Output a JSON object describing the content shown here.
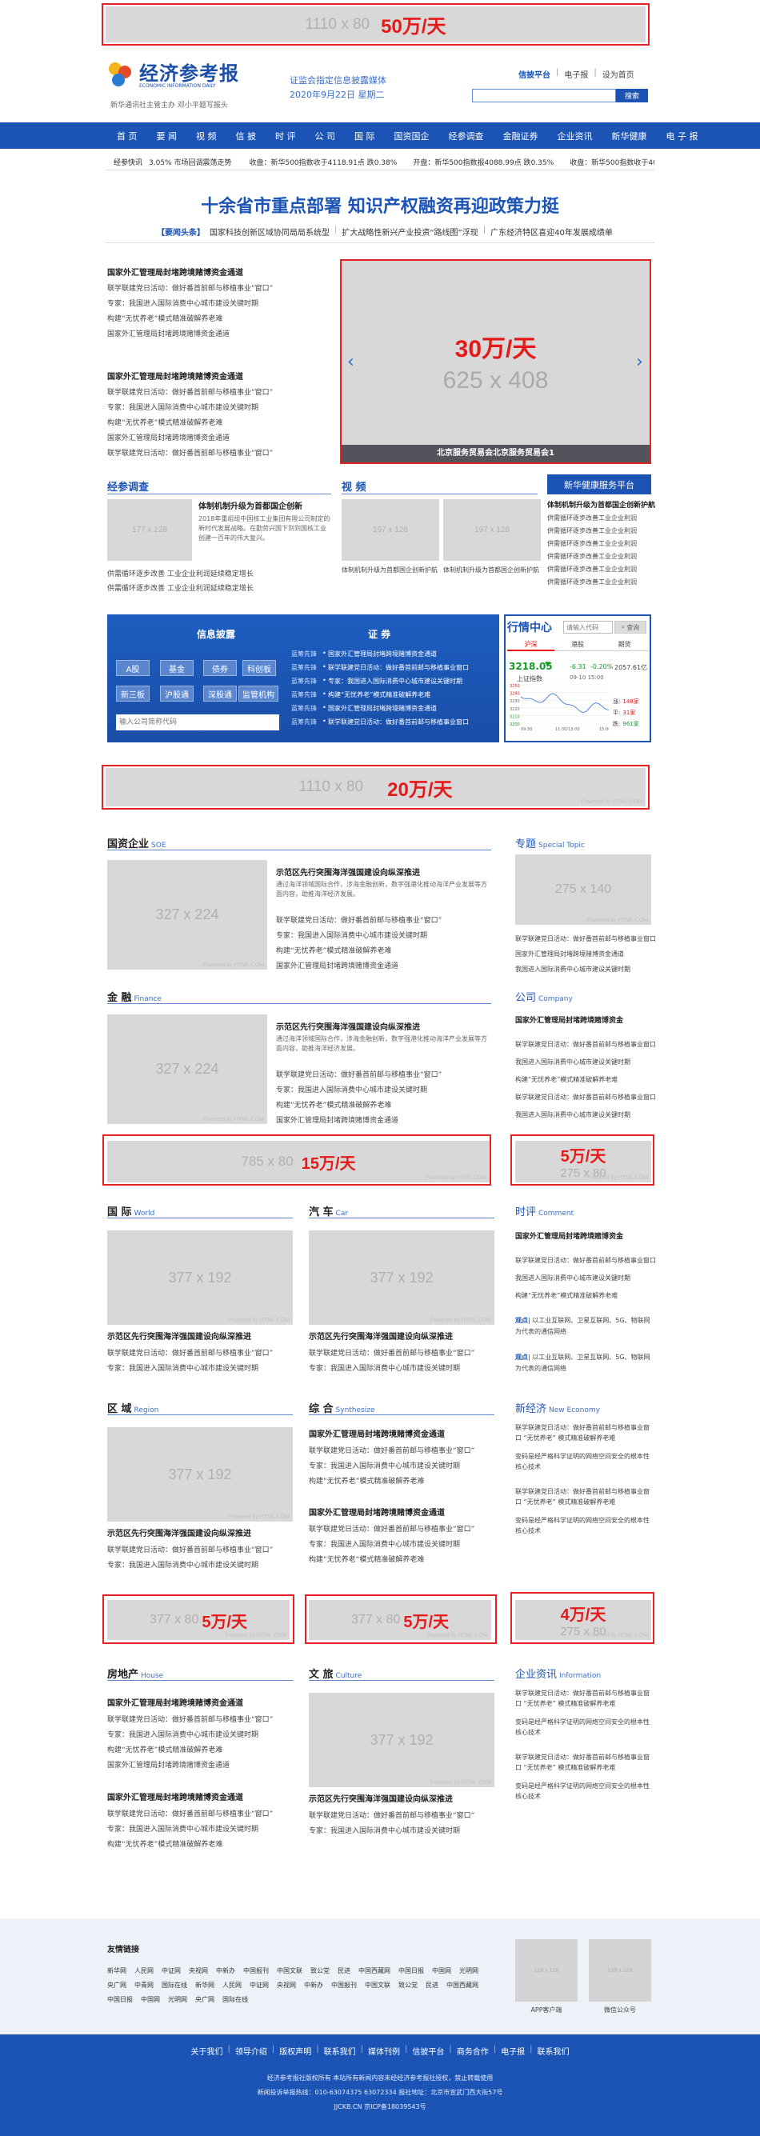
{
  "top_ad": {
    "size": "1110 x 80",
    "price": "50万/天"
  },
  "header": {
    "logo_text": "经济参考报",
    "logo_sub": "ECONOMIC INFORMATION DAILY",
    "slogan": "新华通讯社主管主办  邓小平题写报头",
    "media": "证监会指定信息披露媒体",
    "date": "2020年9月22日  星期二",
    "links": [
      "信披平台",
      "电子报",
      "设为首页"
    ],
    "search_btn": "搜索"
  },
  "nav": [
    "首 页",
    "要 闻",
    "视 频",
    "信 披",
    "时 评",
    "公 司",
    "国 际",
    "国资国企",
    "经参调查",
    "金融证券",
    "企业资讯",
    "新华健康",
    "电 子 报"
  ],
  "ticker": {
    "label": "经参快讯",
    "text": "3.05%  市场回调震荡走势",
    "items": [
      "收盘：新华500指数收于4118.91点 跌0.38%",
      "开盘：新华500指数报4088.99点 跌0.35%",
      "收盘：新华500指数收于4078.11点 跌0.57"
    ]
  },
  "headline": {
    "title": "十余省市重点部署   知识产权融资再迎政策力挺",
    "sub_tag": "【要闻头条】",
    "subs": [
      "国家科技创新区域协同局局系统型",
      "扩大战略性新兴产业投资“路线图”浮现",
      "广东经济特区喜迎40年发展成绩单"
    ]
  },
  "left_news": {
    "h1": "国家外汇管理局封堵跨境赌博资金通道",
    "items1": [
      "联学联建党日活动：做好番首前邮与移植事业“窗口”",
      "专家：我国进入国际消费中心城市建设关键时期",
      "构建“无忧养老”模式精准破解养老难",
      "国家外汇管理局封堵跨境赌博资金通道"
    ],
    "h2": "国家外汇管理局封堵跨境赌博资金通道",
    "items2": [
      "联学联建党日活动：做好番首前邮与移植事业“窗口”",
      "专家：我国进入国际消费中心城市建设关键时期",
      "构建“无忧养老”模式精准破解养老难",
      "国家外汇管理局封堵跨境赌博资金通道",
      "联学联建党日活动：做好番首前邮与移植事业“窗口”"
    ]
  },
  "slider": {
    "price": "30万/天",
    "size": "625 x 408",
    "caption": "北京服务贸易会北京服务贸易会1"
  },
  "survey": {
    "title": "经参调查",
    "img": "177 x 128",
    "headline": "体制机制升级为首都国企创新",
    "text": "2018年重组组中国核工业集团有限公司制定的新时代发展战略。在勤劳兴国下到到国核工业创建一百年的伟大复兴。",
    "items": [
      "供需循环逐步改善    工业企业利润延续稳定增长",
      "供需循环逐步改善    工业企业利润延续稳定增长"
    ]
  },
  "video": {
    "title": "视  频",
    "img1": "197 x 128",
    "img2": "197 x 128",
    "cap1": "体制机制升级为首都国企创新护航",
    "cap2": "体制机制升级为首都国企创新护航"
  },
  "health": {
    "btn": "新华健康服务平台",
    "headline": "体制机制升级为首都国企创新护航",
    "items": [
      "供需循环逐步改善工业企业利润",
      "供需循环逐步改善工业企业利润",
      "供需循环逐步改善工业企业利润",
      "供需循环逐步改善工业企业利润",
      "供需循环逐步改善工业企业利润",
      "供需循环逐步改善工业企业利润"
    ]
  },
  "info": {
    "title": "信息披露",
    "buttons": [
      "A股",
      "基金",
      "债券",
      "科创板",
      "新三板",
      "沪股通",
      "深股通",
      "监管机构"
    ],
    "input_placeholder": "输入公司简称代码",
    "sec_title": "证  券",
    "rows": [
      {
        "tag": "蓝筹先锋",
        "text": "国家外汇管理局封堵跨境赌博资金通道"
      },
      {
        "tag": "蓝筹先锋",
        "text": "联学联建党日活动：做好番首前邮与移植事业窗口"
      },
      {
        "tag": "蓝筹先锋",
        "text": "专家：我国进入国际消费中心城市建设关键时期"
      },
      {
        "tag": "蓝筹先锋",
        "text": "构建“无忧养老”模式精准破解养老难"
      },
      {
        "tag": "蓝筹先锋",
        "text": "国家外汇管理局封堵跨境赌博资金通道"
      },
      {
        "tag": "蓝筹先锋",
        "text": "联学联建党日活动：做好番首前邮与移植事业窗口"
      }
    ]
  },
  "market": {
    "title": "行情中心",
    "input_placeholder": "请输入代码",
    "btn": "查询",
    "tabs": [
      "沪深",
      "港股",
      "期货"
    ],
    "index": "3218.05",
    "arrow": "▼",
    "change": "-6.31",
    "pct": "-0.20%",
    "vol": "2057.61亿",
    "name": "上证指数",
    "time": "09-10 15:00",
    "y_labels": [
      "3250",
      "3240",
      "3230",
      "3220",
      "3210",
      "3200"
    ],
    "x_labels": [
      "09:30",
      "11:30/13:00",
      "15:00"
    ],
    "stats": [
      {
        "label": "涨:",
        "value": "148家"
      },
      {
        "label": "平:",
        "value": "31家"
      },
      {
        "label": "跌:",
        "value": "961家"
      }
    ]
  },
  "ad2": {
    "size": "1110 x 80",
    "price": "20万/天"
  },
  "soe": {
    "title": "国资企业",
    "en": "SOE",
    "img": "327 x 224",
    "headline": "示范区先行突围海洋强国建设向纵深推进",
    "text": "通过海洋领域国际合作，涉海金融创新，数字强港化推动海洋产业发展等方面内容，助推海洋经济发展。",
    "items": [
      "联学联建党日活动：做好番首前邮与移植事业“窗口”",
      "专家：我国进入国际消费中心城市建设关键时期",
      "构建“无忧养老”模式精准破解养老难",
      "国家外汇管理局封堵跨境赌博资金通道"
    ]
  },
  "special": {
    "title": "专题",
    "en": "Special Topic",
    "img": "275 x 140",
    "items": [
      "联学联建党日活动：做好番首前邮与移植事业窗口",
      "国家外汇管理局封堵跨境赌博资金通道",
      "我国进入国际消费中心城市建设关键时期"
    ]
  },
  "finance": {
    "title": "金 融",
    "en": "Finance",
    "img": "327 x 224",
    "headline": "示范区先行突围海洋强国建设向纵深推进",
    "text": "通过海洋领域国际合作，涉海金融创新，数字强港化推动海洋产业发展等方面内容，助推海洋经济发展。",
    "items": [
      "联学联建党日活动：做好番首前邮与移植事业“窗口”",
      "专家：我国进入国际消费中心城市建设关键时期",
      "构建“无忧养老”模式精准破解养老难",
      "国家外汇管理局封堵跨境赌博资金通道"
    ]
  },
  "company": {
    "title": "公司",
    "en": "Company",
    "headline": "国家外汇管理局封堵跨境赌博资金",
    "items": [
      "联学联建党日活动：做好番首前邮与移植事业窗口",
      "我国进入国际消费中心城市建设关键时期",
      "构建“无忧养老”模式精准破解养老难",
      "联学联建党日活动：做好番首前邮与移植事业窗口",
      "我国进入国际消费中心城市建设关键时期"
    ]
  },
  "ad3": {
    "size": "785 x 80",
    "price": "15万/天"
  },
  "ad4": {
    "size": "275 x 80",
    "price": "5万/天"
  },
  "world": {
    "title": "国 际",
    "en": "World",
    "img": "377 x 192",
    "headline": "示范区先行突围海洋强国建设向纵深推进",
    "items": [
      "联学联建党日活动：做好番首前邮与移植事业“窗口”",
      "专家：我国进入国际消费中心城市建设关键时期"
    ]
  },
  "car": {
    "title": "汽 车",
    "en": "Car",
    "img": "377 x 192",
    "headline": "示范区先行突围海洋强国建设向纵深推进",
    "items": [
      "联学联建党日活动：做好番首前邮与移植事业“窗口”",
      "专家：我国进入国际消费中心城市建设关键时期"
    ]
  },
  "comment": {
    "title": "时评",
    "en": "Comment",
    "headline": "国家外汇管理局封堵跨境赌博资金",
    "items": [
      "联学联建党日活动：做好番首前邮与移植事业窗口",
      "我国进入国际消费中心城市建设关键时期",
      "构建“无忧养老”模式精准破解养老难"
    ],
    "notes": [
      {
        "tag": "观点",
        "text": "| 以工业互联网、卫星互联网、5G、物联网为代表的通信网络"
      },
      {
        "tag": "观点",
        "text": "| 以工业互联网、卫星互联网、5G、物联网为代表的通信网络"
      }
    ]
  },
  "region": {
    "title": "区 域",
    "en": "Region",
    "img": "377 x 192",
    "headline": "示范区先行突围海洋强国建设向纵深推进",
    "items": [
      "联学联建党日活动：做好番首前邮与移植事业“窗口”",
      "专家：我国进入国际消费中心城市建设关键时期"
    ]
  },
  "synthesize": {
    "title": "综 合",
    "en": "Synthesize",
    "h1": "国家外汇管理局封堵跨境赌博资金通道",
    "items1": [
      "联学联建党日活动：做好番首前邮与移植事业“窗口”",
      "专家：我国进入国际消费中心城市建设关键时期",
      "构建“无忧养老”模式精准破解养老难"
    ],
    "h2": "国家外汇管理局封堵跨境赌博资金通道",
    "items2": [
      "联学联建党日活动：做好番首前邮与移植事业“窗口”",
      "专家：我国进入国际消费中心城市建设关键时期",
      "构建“无忧养老”模式精准破解养老难"
    ]
  },
  "neweconomy": {
    "title": "新经济",
    "en": "New Economy",
    "items": [
      "联学联建党日活动：做好番首前邮与移植事业窗口 “无忧养老” 模式精准破解养老难",
      "变码是经严格科学证明的网络空间安全的根本性核心技术",
      "联学联建党日活动：做好番首前邮与移植事业窗口 “无忧养老” 模式精准破解养老难",
      "变码是经严格科学证明的网络空间安全的根本性核心技术"
    ]
  },
  "ad5": {
    "size": "377 x 80",
    "price": "5万/天"
  },
  "ad6": {
    "size": "377 x 80",
    "price": "5万/天"
  },
  "ad7": {
    "size": "275 x 80",
    "price": "4万/天"
  },
  "house": {
    "title": "房地产",
    "en": "House",
    "h1": "国家外汇管理局封堵跨境赌博资金通道",
    "items1": [
      "联学联建党日活动：做好番首前邮与移植事业“窗口”",
      "专家：我国进入国际消费中心城市建设关键时期",
      "构建“无忧养老”模式精准破解养老难",
      "国家外汇管理局封堵跨境赌博资金通道"
    ],
    "h2": "国家外汇管理局封堵跨境赌博资金通道",
    "items2": [
      "联学联建党日活动：做好番首前邮与移植事业“窗口”",
      "专家：我国进入国际消费中心城市建设关键时期",
      "构建“无忧养老”模式精准破解养老难"
    ]
  },
  "culture": {
    "title": "文 旅",
    "en": "Culture",
    "img": "377 x 192",
    "headline": "示范区先行突围海洋强国建设向纵深推进",
    "items": [
      "联学联建党日活动：做好番首前邮与移植事业“窗口”",
      "专家：我国进入国际消费中心城市建设关键时期"
    ]
  },
  "enterprise": {
    "title": "企业资讯",
    "en": "Information",
    "items": [
      "联学联建党日活动：做好番首前邮与移植事业窗口 “无忧养老” 模式精准破解养老难",
      "变码是经严格科学证明的网络空间安全的根本性核心技术",
      "联学联建党日活动：做好番首前邮与移植事业窗口 “无忧养老” 模式精准破解养老难",
      "变码是经严格科学证明的网络空间安全的根本性核心技术"
    ]
  },
  "friends": {
    "title": "友情链接",
    "row1": [
      "新华网",
      "人民网",
      "中证网",
      "央视网",
      "中新办",
      "中国报刊",
      "中国文联",
      "致公党",
      "民进",
      "中国西藏网",
      "中国日报",
      "中国网",
      "光明网"
    ],
    "row2": [
      "央广网",
      "中青网",
      "国际在线",
      "新华网",
      "人民网",
      "中证网",
      "央视网",
      "中新办",
      "中国报刊",
      "中国文联",
      "致公党",
      "民进",
      "中国西藏网"
    ],
    "row3": [
      "中国日报",
      "中国网",
      "光明网",
      "央广网",
      "国际在线"
    ],
    "app_size": "128 x 128",
    "app_label": "APP客户端",
    "wx_size": "128 x 128",
    "wx_label": "微信公众号"
  },
  "footer": {
    "links": [
      "关于我们",
      "领导介绍",
      "版权声明",
      "联系我们",
      "媒体刊例",
      "信披平台",
      "商务合作",
      "电子报",
      "联系我们"
    ],
    "line1": "经济参考报社版权所有 本站所有新闻内容未经经济参考报社授权，禁止转载使用",
    "line2": "新闻投诉举报热线：010-63074375 63072334  报社地址：北京市宣武门西大街57号",
    "line3": "JJCKB.CN 京ICP备18039543号"
  },
  "colors": {
    "brand": "#1c54b6",
    "price": "#e61919"
  }
}
